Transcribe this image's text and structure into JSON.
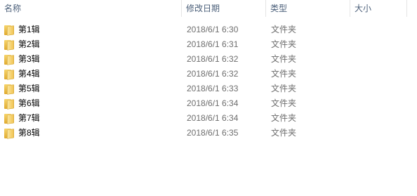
{
  "columns": {
    "name": "名称",
    "modified": "修改日期",
    "type": "类型",
    "size": "大小"
  },
  "icons": {
    "folder": "folder-icon",
    "sort": "sort-ascending-icon"
  },
  "files": [
    {
      "name": "第1辑",
      "modified": "2018/6/1 6:30",
      "type": "文件夹",
      "size": ""
    },
    {
      "name": "第2辑",
      "modified": "2018/6/1 6:31",
      "type": "文件夹",
      "size": ""
    },
    {
      "name": "第3辑",
      "modified": "2018/6/1 6:32",
      "type": "文件夹",
      "size": ""
    },
    {
      "name": "第4辑",
      "modified": "2018/6/1 6:32",
      "type": "文件夹",
      "size": ""
    },
    {
      "name": "第5辑",
      "modified": "2018/6/1 6:33",
      "type": "文件夹",
      "size": ""
    },
    {
      "name": "第6辑",
      "modified": "2018/6/1 6:34",
      "type": "文件夹",
      "size": ""
    },
    {
      "name": "第7辑",
      "modified": "2018/6/1 6:34",
      "type": "文件夹",
      "size": ""
    },
    {
      "name": "第8辑",
      "modified": "2018/6/1 6:35",
      "type": "文件夹",
      "size": ""
    }
  ]
}
